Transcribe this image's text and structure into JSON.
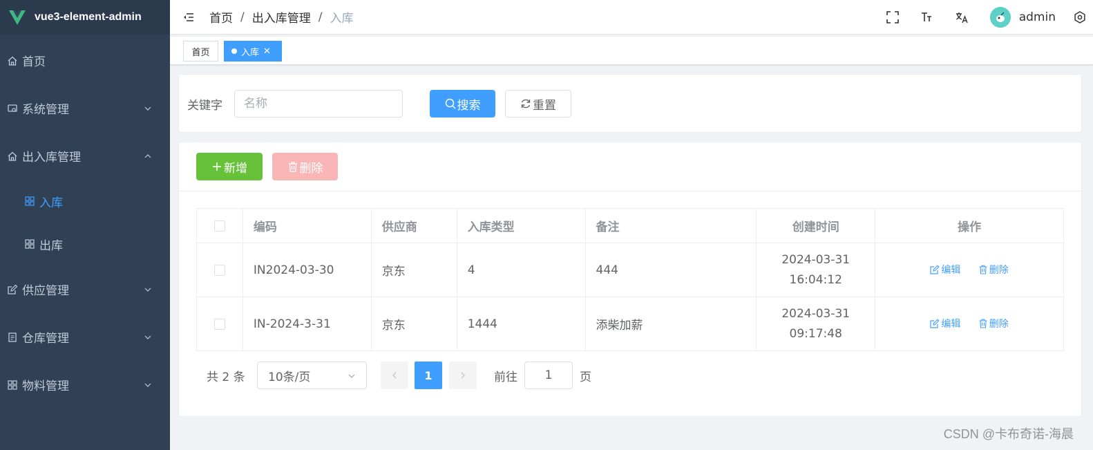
{
  "app": {
    "title": "vue3-element-admin"
  },
  "sidebar": {
    "items": [
      {
        "label": "首页",
        "icon": "home-icon"
      },
      {
        "label": "系统管理",
        "icon": "system-icon"
      },
      {
        "label": "出入库管理",
        "icon": "home-icon"
      },
      {
        "label": "入库",
        "icon": "grid-icon"
      },
      {
        "label": "出库",
        "icon": "grid-icon"
      },
      {
        "label": "供应管理",
        "icon": "edit-icon"
      },
      {
        "label": "仓库管理",
        "icon": "document-icon"
      },
      {
        "label": "物料管理",
        "icon": "grid-icon"
      }
    ]
  },
  "breadcrumb": [
    "首页",
    "出入库管理",
    "入库"
  ],
  "breadcrumb_sep": "/",
  "user": {
    "name": "admin"
  },
  "tags": [
    {
      "label": "首页"
    },
    {
      "label": "入库"
    }
  ],
  "search": {
    "label": "关键字",
    "placeholder": "名称",
    "value": "",
    "search_label": "搜索",
    "reset_label": "重置"
  },
  "toolbar": {
    "add_label": "新增",
    "delete_label": "删除"
  },
  "table": {
    "headers": [
      "编码",
      "供应商",
      "入库类型",
      "备注",
      "创建时间",
      "操作"
    ],
    "rows": [
      {
        "code": "IN2024-03-30",
        "supplier": "京东",
        "type": "4",
        "remark": "444",
        "date": "2024-03-31",
        "time": "16:04:12"
      },
      {
        "code": "IN-2024-3-31",
        "supplier": "京东",
        "type": "1444",
        "remark": "添柴加薪",
        "date": "2024-03-31",
        "time": "09:17:48"
      }
    ],
    "op_edit": "编辑",
    "op_delete": "删除"
  },
  "pagination": {
    "total_text": "共 2 条",
    "page_size": "10条/页",
    "current_page": "1",
    "goto_label": "前往",
    "goto_value": "1",
    "page_unit": "页"
  },
  "watermark": "CSDN @卡布奇诺-海晨",
  "colors": {
    "sidebar_bg": "#304156",
    "primary": "#409eff",
    "success": "#67c23a",
    "danger_light": "#fab6b6"
  }
}
